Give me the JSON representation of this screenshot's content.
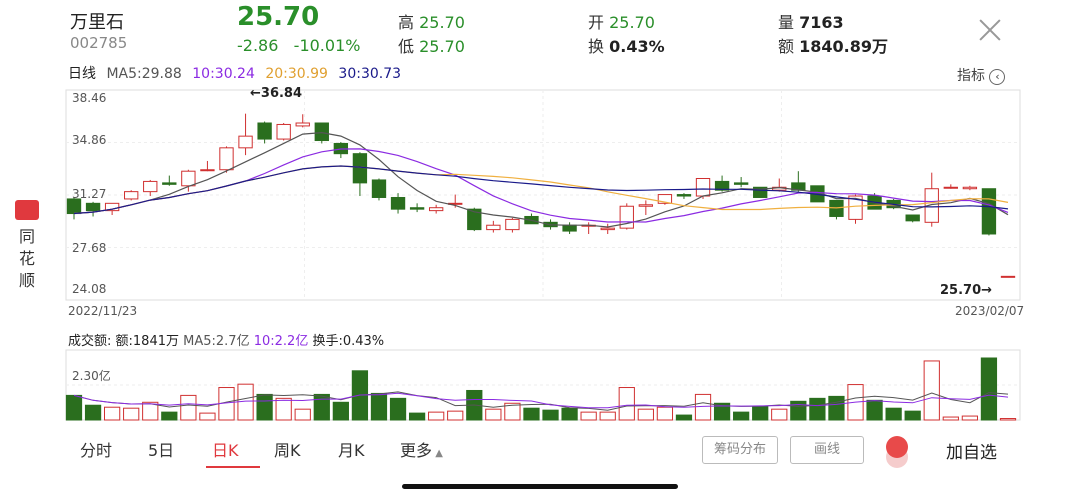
{
  "stock": {
    "name": "万里石",
    "code": "002785",
    "price": "25.70",
    "change": "-2.86",
    "change_pct": "-10.01%",
    "high_label": "高",
    "high": "25.70",
    "low_label": "低",
    "low": "25.70",
    "open_label": "开",
    "open": "25.70",
    "turnover_label": "换",
    "turnover": "0.43%",
    "volume_label": "量",
    "volume": "7163",
    "amount_label": "额",
    "amount": "1840.89万"
  },
  "ma": {
    "period": "日线",
    "ma5": "MA5:29.88",
    "ma10": "10:30.24",
    "ma20": "20:30.99",
    "ma30": "30:30.73",
    "colors": {
      "ma5": "#555555",
      "ma10": "#8b2be2",
      "ma20": "#f0b040",
      "ma30": "#1a1a8a"
    }
  },
  "indicator_button": "指标",
  "price_axis": [
    "38.46",
    "34.86",
    "31.27",
    "27.68",
    "24.08"
  ],
  "annotations": {
    "high_mark": "←36.84",
    "last_mark": "25.70→"
  },
  "dates": {
    "start": "2022/11/23",
    "end": "2023/02/07"
  },
  "sidebar": {
    "label_1": "同",
    "label_2": "花",
    "label_3": "顺"
  },
  "volume_panel": {
    "title": "成交额:",
    "amount": "额:1841万",
    "ma5": "MA5:2.7亿",
    "ma10": "10:2.2亿",
    "turnover": "换手:0.43%",
    "axis_label": "2.30亿"
  },
  "tabs": [
    "分时",
    "5日",
    "日K",
    "周K",
    "月K",
    "更多"
  ],
  "active_tab": "日K",
  "buttons": {
    "chip": "筹码分布",
    "draw": "画线",
    "watch": "加自选"
  },
  "colors": {
    "up": "#d03030",
    "down": "#2a6e1e",
    "accent": "#e0393e",
    "green_text": "#2a8f2a"
  },
  "chart_data": {
    "type": "candlestick",
    "ylim": [
      24.08,
      38.46
    ],
    "candles": [
      [
        31.0,
        31.1,
        29.6,
        30.0
      ],
      [
        30.7,
        30.8,
        29.8,
        30.2
      ],
      [
        30.2,
        30.7,
        29.9,
        30.7
      ],
      [
        31.0,
        31.6,
        30.9,
        31.5
      ],
      [
        31.5,
        32.3,
        31.2,
        32.2
      ],
      [
        32.1,
        32.6,
        31.9,
        32.0
      ],
      [
        31.9,
        33.0,
        31.5,
        32.9
      ],
      [
        33.0,
        33.6,
        32.9,
        33.0
      ],
      [
        33.0,
        34.6,
        32.8,
        34.5
      ],
      [
        34.5,
        36.84,
        34.0,
        35.3
      ],
      [
        36.2,
        36.3,
        34.8,
        35.1
      ],
      [
        35.1,
        36.2,
        35.0,
        36.1
      ],
      [
        36.0,
        36.8,
        35.9,
        36.2
      ],
      [
        36.2,
        36.2,
        34.8,
        35.0
      ],
      [
        34.8,
        34.9,
        33.8,
        34.1
      ],
      [
        34.1,
        34.2,
        31.2,
        32.1
      ],
      [
        32.3,
        32.4,
        30.9,
        31.1
      ],
      [
        31.1,
        31.4,
        30.0,
        30.3
      ],
      [
        30.4,
        30.7,
        30.1,
        30.3
      ],
      [
        30.2,
        30.6,
        30.0,
        30.4
      ],
      [
        30.7,
        31.3,
        30.4,
        30.7
      ],
      [
        30.3,
        30.4,
        28.8,
        28.9
      ],
      [
        28.9,
        29.5,
        28.7,
        29.2
      ],
      [
        28.9,
        29.7,
        28.7,
        29.6
      ],
      [
        29.8,
        30.0,
        29.3,
        29.3
      ],
      [
        29.4,
        29.6,
        28.9,
        29.1
      ],
      [
        29.2,
        29.4,
        28.6,
        28.8
      ],
      [
        29.2,
        29.4,
        28.6,
        29.2
      ],
      [
        28.9,
        29.3,
        28.6,
        29.0
      ],
      [
        29.0,
        30.7,
        28.9,
        30.5
      ],
      [
        30.5,
        30.9,
        29.9,
        30.6
      ],
      [
        30.7,
        31.3,
        30.6,
        31.3
      ],
      [
        31.3,
        31.4,
        31.0,
        31.2
      ],
      [
        31.2,
        32.4,
        31.0,
        32.4
      ],
      [
        32.2,
        32.6,
        31.5,
        31.6
      ],
      [
        32.1,
        32.5,
        31.8,
        32.0
      ],
      [
        31.8,
        31.8,
        31.1,
        31.1
      ],
      [
        31.6,
        32.4,
        31.5,
        31.8
      ],
      [
        32.1,
        32.9,
        31.5,
        31.6
      ],
      [
        31.9,
        31.9,
        30.8,
        30.8
      ],
      [
        30.9,
        30.9,
        29.6,
        29.8
      ],
      [
        29.6,
        31.3,
        29.3,
        31.2
      ],
      [
        31.2,
        31.4,
        30.3,
        30.3
      ],
      [
        30.9,
        31.0,
        30.3,
        30.4
      ],
      [
        29.9,
        29.9,
        29.4,
        29.5
      ],
      [
        29.4,
        32.8,
        29.1,
        31.7
      ],
      [
        31.8,
        32.0,
        31.7,
        31.8
      ],
      [
        31.7,
        31.9,
        31.6,
        31.8
      ],
      [
        31.7,
        31.7,
        28.5,
        28.6
      ],
      [
        25.7,
        25.7,
        25.7,
        25.7
      ]
    ],
    "volume": [],
    "xlabel": "",
    "ylabel": ""
  }
}
